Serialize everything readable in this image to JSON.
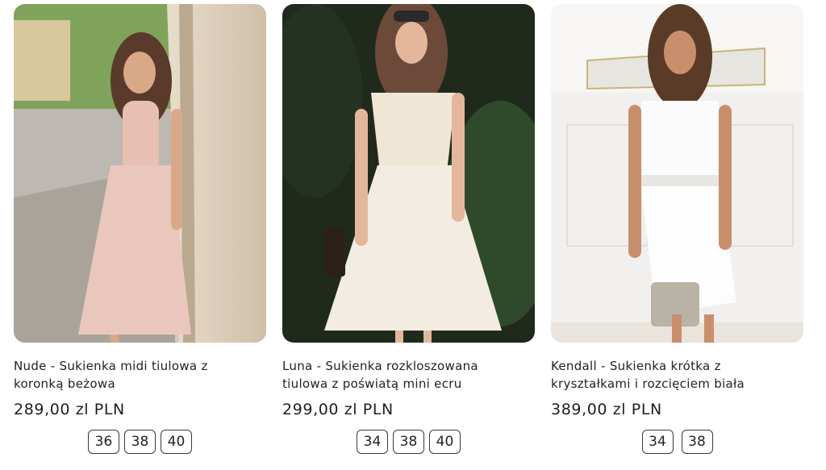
{
  "products": [
    {
      "title_line1": "Nude - Sukienka midi tiulowa z",
      "title_line2": "koronką beżowa",
      "price": "289,00 zl PLN",
      "sizes": [
        "36",
        "38",
        "40"
      ],
      "image": "photo of model in blush pink lace-bodice midi tulle dress"
    },
    {
      "title_line1": "Luna - Sukienka rozkloszowana",
      "title_line2": "tiulowa z poświatą mini ecru",
      "price": "299,00 zl PLN",
      "sizes": [
        "34",
        "38",
        "40"
      ],
      "image": "photo of model in ecru wrap-top tulle mini dress"
    },
    {
      "title_line1": "Kendall - Sukienka krótka z",
      "title_line2": "kryształkami i rozcięciem biała",
      "price": "389,00 zl PLN",
      "sizes": [
        "34",
        "38"
      ],
      "image": "photo of model in white fitted dress with crystal waistband"
    }
  ],
  "colors": {
    "card_text": "#222222",
    "size_border": "#3a3a3a"
  }
}
